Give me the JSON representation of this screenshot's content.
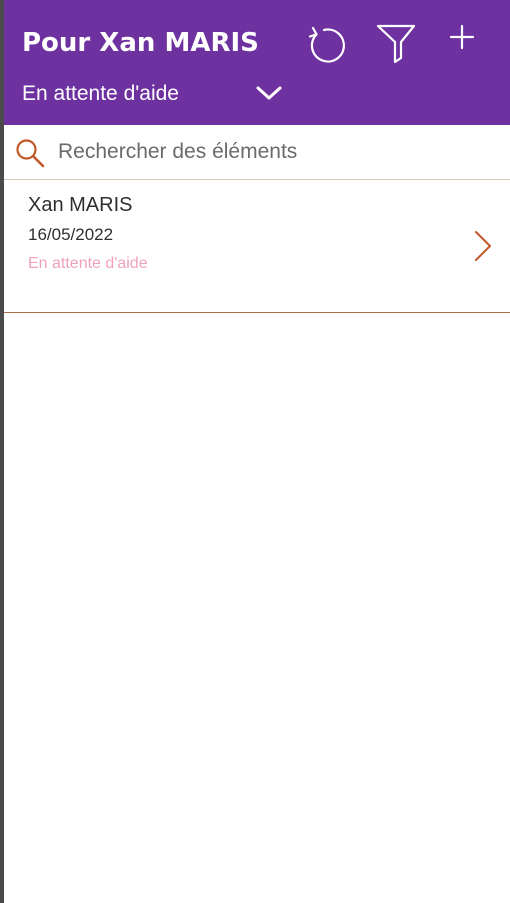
{
  "header": {
    "title": "Pour Xan MARIS",
    "status_filter_label": "En attente d'aide",
    "icons": [
      "refresh-icon",
      "filter-icon",
      "add-icon",
      "chevron-down-icon"
    ]
  },
  "search": {
    "placeholder": "Rechercher des éléments",
    "value": ""
  },
  "list": {
    "items": [
      {
        "name": "Xan MARIS",
        "date": "16/05/2022",
        "status": "En attente d'aide"
      }
    ]
  },
  "colors": {
    "header_bg": "#6e31a0",
    "accent": "#c0582a",
    "status_text": "#f0a3b8"
  }
}
